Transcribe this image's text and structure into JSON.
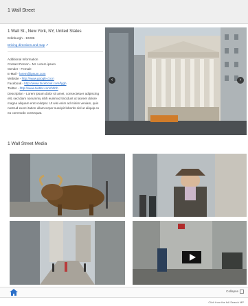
{
  "header": {
    "title": "1 Wall Street"
  },
  "info": {
    "address": "1 Wall St., New York, NY, United States",
    "city_zip": "Edinburgh - 10286",
    "directions_link": "Driving directions and map",
    "section_title": "Additional Information",
    "contact": "Contact Person - Mr. Lorem ipsum",
    "gender": "Gender - Female",
    "email_label": "E-Mail - ",
    "email": "lorem@ipsum.com",
    "website_label": "Website - ",
    "website": "http://www.google.co.in",
    "facebook_label": "Facebook - ",
    "facebook": "http://www.facebook.com/fggh",
    "twitter_label": "Twitter - ",
    "twitter": "http://www.twitter.com/hhhh",
    "description": "Description - Lorem ipsum dolor sit amet, consectetuer adipiscing elit, sed diam nonummy nibh euismod tincidunt ut laoreet dolore magna aliquam erat volutpat. Ut wisi enim ad minim veniam, quis nostrud exerci tation ullamcorper suscipit lobortis nisl ut aliquip ex ea commodo consequat."
  },
  "hero_nav": {
    "prev": "‹",
    "next": "›"
  },
  "media": {
    "title": "1 Wall Street Media",
    "tiles": [
      "charging-bull-photo",
      "wall-street-man-photo",
      "street-view-photo",
      "street-video-thumbnail"
    ]
  },
  "footer": {
    "home_icon": "home-icon",
    "collapse_label": "Collapse",
    "copyright": "Click from the full Search MP"
  }
}
